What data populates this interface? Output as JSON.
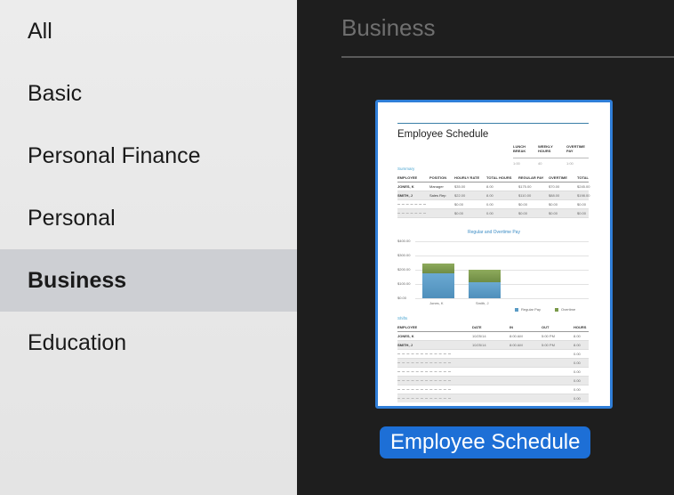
{
  "sidebar": {
    "items": [
      {
        "label": "All",
        "selected": false
      },
      {
        "label": "Basic",
        "selected": false
      },
      {
        "label": "Personal Finance",
        "selected": false
      },
      {
        "label": "Personal",
        "selected": false
      },
      {
        "label": "Business",
        "selected": true
      },
      {
        "label": "Education",
        "selected": false
      }
    ]
  },
  "main": {
    "section_title": "Business",
    "template": {
      "name": "Employee Schedule",
      "selected": true,
      "preview": {
        "title": "Employee Schedule",
        "summary_headers": [
          "LUNCH BREAK",
          "WEEKLY HOURS",
          "OVERTIME PAY"
        ],
        "summary_values": [
          "1:00",
          "40",
          "1:00"
        ],
        "summary_tag": "Summary",
        "columns": [
          "EMPLOYEE",
          "POSITION",
          "HOURLY RATE",
          "TOTAL HOURS",
          "REGULAR PAY",
          "OVERTIME",
          "TOTAL"
        ],
        "rows": [
          [
            "JONES, K",
            "Manager",
            "$35.00",
            "8.00",
            "$175.00",
            "$70.00",
            "$245.00"
          ],
          [
            "SMITH, J",
            "Sales Rep",
            "$22.00",
            "8.00",
            "$110.00",
            "$88.00",
            "$198.00"
          ],
          [
            "",
            "",
            "$0.00",
            "0.00",
            "$0.00",
            "$0.00",
            "$0.00"
          ],
          [
            "",
            "",
            "$0.00",
            "0.00",
            "$0.00",
            "$0.00",
            "$0.00"
          ]
        ],
        "chart_title": "Regular and Overtime Pay",
        "y_ticks": [
          "$400.00",
          "$300.00",
          "$200.00",
          "$100.00",
          "$0.00"
        ],
        "legend": [
          {
            "name": "Regular Pay",
            "color": "#5a9bc5"
          },
          {
            "name": "Overtime",
            "color": "#7a9a4a"
          }
        ],
        "shift_tag": "Shifts",
        "shift_columns": [
          "EMPLOYEE",
          "DATE",
          "IN",
          "OUT",
          "HOURS"
        ],
        "shift_rows": [
          [
            "JONES, K",
            "10/25/14",
            "8:00 AM",
            "5:00 PM",
            "8.00"
          ],
          [
            "SMITH, J",
            "10/25/14",
            "8:00 AM",
            "5:00 PM",
            "8.00"
          ],
          [
            "",
            "",
            "",
            "",
            "0.00"
          ],
          [
            "",
            "",
            "",
            "",
            "0.00"
          ],
          [
            "",
            "",
            "",
            "",
            "0.00"
          ],
          [
            "",
            "",
            "",
            "",
            "0.00"
          ],
          [
            "",
            "",
            "",
            "",
            "0.00"
          ],
          [
            "",
            "",
            "",
            "",
            "0.00"
          ]
        ]
      }
    }
  },
  "chart_data": {
    "type": "bar",
    "title": "Regular and Overtime Pay",
    "categories": [
      "Jones, K",
      "Smith, J"
    ],
    "series": [
      {
        "name": "Regular Pay",
        "values": [
          175,
          110
        ]
      },
      {
        "name": "Overtime",
        "values": [
          70,
          88
        ]
      }
    ],
    "ylim": [
      0,
      400
    ],
    "stacked": true
  },
  "colors": {
    "selection_blue": "#1d6fd6",
    "thumb_border": "#2f7ed8",
    "sidebar_bg": "#e8e8e8",
    "sidebar_selected": "#cdcfd3",
    "main_bg": "#1e1e1e"
  }
}
